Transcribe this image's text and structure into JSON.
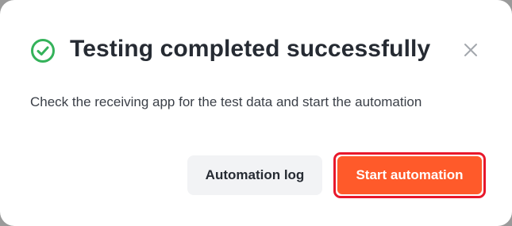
{
  "dialog": {
    "title": "Testing completed successfully",
    "message": "Check the receiving app for the test data and start the automation",
    "secondary_button": "Automation log",
    "primary_button": "Start automation"
  },
  "icons": {
    "status": "check-circle-icon",
    "close": "close-icon"
  },
  "colors": {
    "success": "#34b25a",
    "primary": "#ff5a2a",
    "highlight_border": "#e8182b",
    "title_text": "#262b33"
  }
}
